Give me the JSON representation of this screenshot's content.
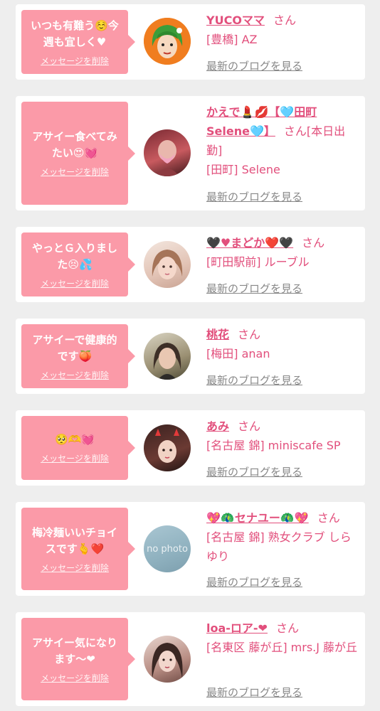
{
  "delete_label": "メッセージを削除",
  "blog_label": "最新のブログを見る",
  "san_label": "さん",
  "colors": {
    "accent": "#fb9aa8",
    "name": "#e24f7c",
    "background": "#eeeeee"
  },
  "messages": [
    {
      "text": "いつも有難う☺️今週も宜しく♥",
      "name": "YUCOママ",
      "san": "さん",
      "shop": "[豊橋] AZ",
      "avatar": "green-hair-illustration"
    },
    {
      "text": "アサイー食べてみたい😍💓",
      "name": "かえで💄💋【🩵田町Selene🩵】",
      "san": "さん[本日出勤]",
      "shop": "[田町] Selene",
      "avatar": "woman-photo"
    },
    {
      "text": "やっとＧ入りました😣💦",
      "name": "🖤♥まどか❤️🖤",
      "san": "さん",
      "shop": "[町田駅前] ルーブル",
      "avatar": "woman-photo"
    },
    {
      "text": "アサイーで健康的です🍑",
      "name": "桃花",
      "san": "さん",
      "shop": "[梅田] anan",
      "avatar": "woman-photo"
    },
    {
      "text": "🥺🫶💓",
      "name": "あみ",
      "san": "さん",
      "shop": "[名古屋 錦] miniscafe SP",
      "avatar": "woman-photo"
    },
    {
      "text": "梅冷麺いいチョイスです🫰❤️",
      "name": "💖🦚セナユー🦚💖",
      "san": "さん",
      "shop": "[名古屋 錦] 熟女クラブ しらゆり",
      "avatar": "no-photo",
      "nophoto_text": "no photo"
    },
    {
      "text": "アサイー気になります〜❤",
      "name": "loa-ロア-❤",
      "san": "さん",
      "shop": "[名東区 藤が丘] mrs.J 藤が丘",
      "avatar": "woman-photo"
    }
  ]
}
